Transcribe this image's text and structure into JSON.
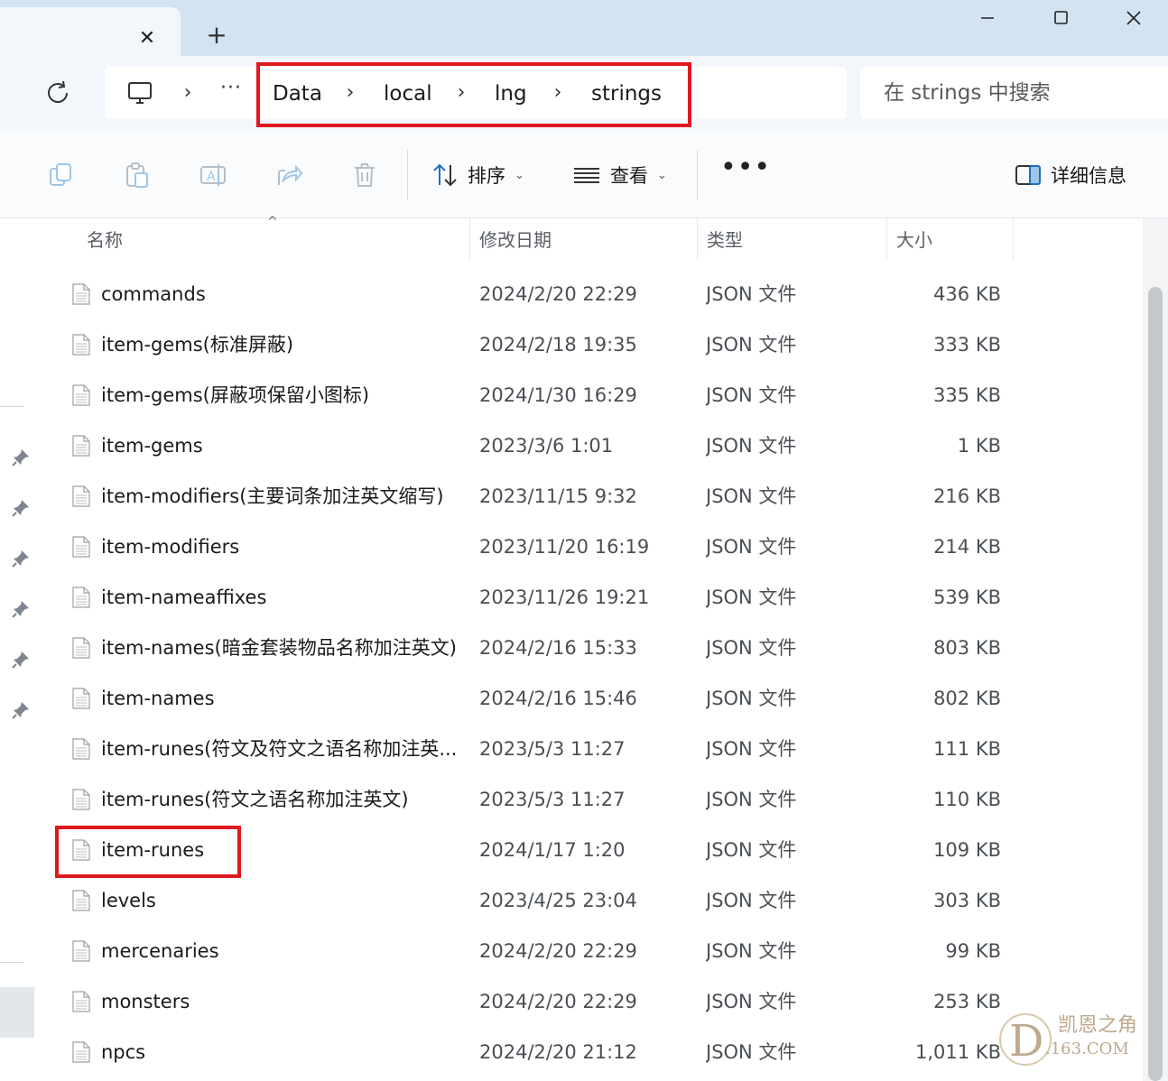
{
  "titlebar": {
    "tab_close": "✕",
    "new_tab": "+",
    "minimize": "—",
    "maximize": "▢",
    "close": "✕"
  },
  "address": {
    "more": "···",
    "separator": "›",
    "crumbs": [
      "Data",
      "local",
      "lng",
      "strings"
    ]
  },
  "search": {
    "placeholder": "在 strings 中搜索"
  },
  "toolbar": {
    "sort_label": "排序",
    "view_label": "查看",
    "more": "•••",
    "details_label": "详细信息",
    "chevron": "⌄"
  },
  "columns": {
    "name": "名称",
    "date": "修改日期",
    "type": "类型",
    "size": "大小",
    "sort_indicator": "^"
  },
  "files": [
    {
      "name": "commands",
      "date": "2024/2/20 22:29",
      "type": "JSON 文件",
      "size": "436 KB"
    },
    {
      "name": "item-gems(标准屏蔽)",
      "date": "2024/2/18 19:35",
      "type": "JSON 文件",
      "size": "333 KB"
    },
    {
      "name": "item-gems(屏蔽项保留小图标)",
      "date": "2024/1/30 16:29",
      "type": "JSON 文件",
      "size": "335 KB"
    },
    {
      "name": "item-gems",
      "date": "2023/3/6 1:01",
      "type": "JSON 文件",
      "size": "1 KB"
    },
    {
      "name": "item-modifiers(主要词条加注英文缩写)",
      "date": "2023/11/15 9:32",
      "type": "JSON 文件",
      "size": "216 KB"
    },
    {
      "name": "item-modifiers",
      "date": "2023/11/20 16:19",
      "type": "JSON 文件",
      "size": "214 KB"
    },
    {
      "name": "item-nameaffixes",
      "date": "2023/11/26 19:21",
      "type": "JSON 文件",
      "size": "539 KB"
    },
    {
      "name": "item-names(暗金套装物品名称加注英文)",
      "date": "2024/2/16 15:33",
      "type": "JSON 文件",
      "size": "803 KB"
    },
    {
      "name": "item-names",
      "date": "2024/2/16 15:46",
      "type": "JSON 文件",
      "size": "802 KB"
    },
    {
      "name": "item-runes(符文及符文之语名称加注英...",
      "date": "2023/5/3 11:27",
      "type": "JSON 文件",
      "size": "111 KB"
    },
    {
      "name": "item-runes(符文之语名称加注英文)",
      "date": "2023/5/3 11:27",
      "type": "JSON 文件",
      "size": "110 KB"
    },
    {
      "name": "item-runes",
      "date": "2024/1/17 1:20",
      "type": "JSON 文件",
      "size": "109 KB"
    },
    {
      "name": "levels",
      "date": "2023/4/25 23:04",
      "type": "JSON 文件",
      "size": "303 KB"
    },
    {
      "name": "mercenaries",
      "date": "2024/2/20 22:29",
      "type": "JSON 文件",
      "size": "99 KB"
    },
    {
      "name": "monsters",
      "date": "2024/2/20 22:29",
      "type": "JSON 文件",
      "size": "253 KB"
    },
    {
      "name": "npcs",
      "date": "2024/2/20 21:12",
      "type": "JSON 文件",
      "size": "1,011 KB"
    }
  ],
  "watermark": {
    "line1": "凯恩之角",
    "line2": ".163.COM",
    "accent": "#b59a7a"
  },
  "colors": {
    "highlight": "#e0181f",
    "titlebar": "#d3e3f1",
    "addressbar": "#f3f7fb"
  }
}
